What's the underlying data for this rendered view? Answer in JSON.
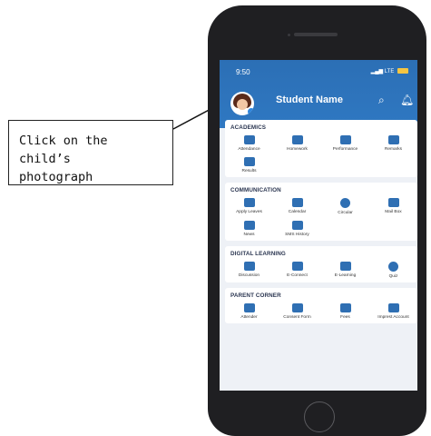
{
  "callout": {
    "line1": "Click on the child’s",
    "line2": "photograph"
  },
  "status": {
    "time": "9:50",
    "network": "LTE"
  },
  "header": {
    "student_name": "Student Name"
  },
  "sections": [
    {
      "title": "ACADEMICS",
      "items": [
        "Attendance",
        "Homework",
        "Performance",
        "Remarks",
        "Results"
      ]
    },
    {
      "title": "COMMUNICATION",
      "items": [
        "Apply Leaves",
        "Calendar",
        "Circular",
        "Mail Box",
        "News",
        "SMS History"
      ]
    },
    {
      "title": "DIGITAL LEARNING",
      "items": [
        "Discussion",
        "E-Connect",
        "E-Learning",
        "Quiz"
      ]
    },
    {
      "title": "PARENT CORNER",
      "items": [
        "Attender",
        "Consent Form",
        "Fees",
        "Imprest Account"
      ]
    }
  ],
  "colors": {
    "header": "#2f78c2",
    "icon": "#2f6fb3",
    "phone": "#1f1f22"
  }
}
